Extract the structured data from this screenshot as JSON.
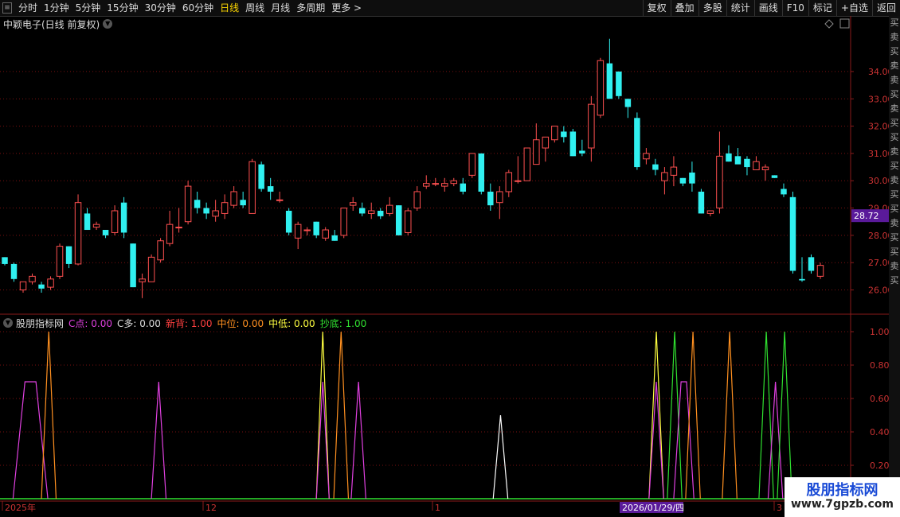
{
  "toolbar": {
    "periods": [
      "分时",
      "1分钟",
      "5分钟",
      "15分钟",
      "30分钟",
      "60分钟",
      "日线",
      "周线",
      "月线",
      "多周期",
      "更多 >"
    ],
    "active_period": "日线",
    "right_buttons": [
      "复权",
      "叠加",
      "多股",
      "统计",
      "画线",
      "F10",
      "标记",
      "+自选",
      "返回"
    ]
  },
  "main_title": "中颖电子(日线 前复权)",
  "indicator": {
    "name": "股朋指标网",
    "params": [
      {
        "label": "C点: 0.00",
        "color": "#e040e0"
      },
      {
        "label": "C多: 0.00",
        "color": "#dddddd"
      },
      {
        "label": "新背: 1.00",
        "color": "#ff4040"
      },
      {
        "label": "中位: 0.00",
        "color": "#ff9020"
      },
      {
        "label": "中低: 0.00",
        "color": "#ffff40"
      },
      {
        "label": "抄底: 1.00",
        "color": "#30e030"
      }
    ]
  },
  "price_axis": [
    "34.00",
    "33.00",
    "32.00",
    "31.00",
    "30.00",
    "29.00",
    "28.00",
    "27.00",
    "26.00"
  ],
  "current_price": "28.72",
  "ind_axis": [
    "1.00",
    "0.80",
    "0.60",
    "0.40",
    "0.20"
  ],
  "date_axis": {
    "labels": [
      "2025年",
      "12",
      "1",
      "3"
    ],
    "cursor": "2026/01/29/四"
  },
  "side_text": "买卖买卖卖买卖买买卖买卖买买卖买买卖买",
  "watermark": {
    "title": "股朋指标网",
    "url": "www.7gpzb.com"
  },
  "colors": {
    "up": "#ff5050",
    "down": "#30f0f0",
    "grid": "#7a1010",
    "axis": "#8a1a1a",
    "price_tag": "#5a1a9a",
    "date_tag": "#5a1a9a"
  },
  "chart_data": {
    "type": "candlestick",
    "title": "中颖电子(日线 前复权)",
    "ylim": [
      25.2,
      35.6
    ],
    "candles": [
      [
        27.2,
        27.2,
        26.9,
        26.95
      ],
      [
        26.95,
        27.0,
        26.3,
        26.4
      ],
      [
        26.0,
        26.3,
        25.9,
        26.3
      ],
      [
        26.3,
        26.6,
        26.2,
        26.5
      ],
      [
        26.2,
        26.3,
        25.9,
        26.05
      ],
      [
        26.1,
        26.5,
        26.0,
        26.4
      ],
      [
        26.5,
        27.7,
        26.4,
        27.6
      ],
      [
        27.6,
        27.6,
        26.8,
        26.95
      ],
      [
        26.95,
        29.5,
        26.9,
        29.2
      ],
      [
        28.8,
        29.0,
        28.2,
        28.2
      ],
      [
        28.3,
        28.5,
        28.2,
        28.4
      ],
      [
        28.2,
        28.2,
        27.9,
        28.0
      ],
      [
        28.1,
        29.1,
        28.0,
        28.9
      ],
      [
        29.2,
        29.4,
        27.9,
        28.1
      ],
      [
        27.7,
        27.7,
        26.1,
        26.1
      ],
      [
        26.3,
        26.6,
        25.7,
        26.4
      ],
      [
        26.3,
        27.3,
        26.3,
        27.2
      ],
      [
        27.1,
        27.9,
        27.0,
        27.8
      ],
      [
        27.7,
        28.9,
        27.6,
        28.4
      ],
      [
        28.3,
        29.0,
        28.1,
        28.3
      ],
      [
        28.5,
        30.0,
        28.4,
        29.8
      ],
      [
        29.3,
        29.6,
        28.8,
        29.0
      ],
      [
        29.0,
        29.2,
        28.6,
        28.8
      ],
      [
        28.7,
        29.3,
        28.5,
        28.9
      ],
      [
        28.8,
        29.5,
        28.6,
        29.2
      ],
      [
        29.1,
        29.8,
        29.0,
        29.6
      ],
      [
        29.3,
        29.6,
        29.0,
        29.1
      ],
      [
        28.8,
        30.8,
        28.8,
        30.7
      ],
      [
        30.6,
        30.7,
        29.6,
        29.7
      ],
      [
        29.8,
        30.1,
        29.3,
        29.6
      ],
      [
        29.3,
        29.6,
        29.2,
        29.3
      ],
      [
        28.9,
        29.0,
        28.0,
        28.1
      ],
      [
        27.9,
        28.5,
        27.5,
        28.4
      ],
      [
        28.2,
        28.3,
        28.0,
        28.2
      ],
      [
        28.5,
        28.5,
        27.9,
        28.0
      ],
      [
        27.9,
        28.3,
        27.8,
        28.2
      ],
      [
        28.0,
        28.2,
        27.8,
        27.8
      ],
      [
        28.0,
        29.0,
        27.9,
        29.0
      ],
      [
        29.1,
        29.4,
        28.9,
        29.2
      ],
      [
        29.0,
        29.2,
        28.7,
        28.8
      ],
      [
        28.8,
        29.2,
        28.6,
        28.9
      ],
      [
        28.9,
        29.0,
        28.6,
        28.7
      ],
      [
        28.8,
        29.4,
        28.7,
        29.1
      ],
      [
        29.1,
        29.1,
        28.0,
        28.0
      ],
      [
        28.1,
        29.0,
        28.0,
        28.9
      ],
      [
        29.0,
        29.8,
        28.9,
        29.6
      ],
      [
        29.8,
        30.2,
        29.7,
        29.9
      ],
      [
        29.9,
        30.1,
        29.8,
        29.9
      ],
      [
        29.8,
        30.1,
        29.6,
        29.9
      ],
      [
        29.9,
        30.1,
        29.8,
        30.0
      ],
      [
        29.9,
        30.1,
        29.5,
        29.6
      ],
      [
        30.2,
        31.0,
        30.1,
        31.0
      ],
      [
        31.0,
        31.0,
        29.5,
        29.6
      ],
      [
        29.6,
        29.9,
        28.9,
        29.1
      ],
      [
        29.2,
        29.8,
        28.6,
        29.6
      ],
      [
        29.6,
        30.4,
        29.4,
        30.3
      ],
      [
        30.0,
        30.9,
        29.9,
        30.0
      ],
      [
        30.0,
        31.2,
        30.0,
        31.2
      ],
      [
        30.6,
        32.1,
        30.6,
        31.5
      ],
      [
        31.2,
        31.6,
        30.7,
        31.6
      ],
      [
        31.5,
        32.0,
        31.4,
        32.0
      ],
      [
        31.8,
        32.0,
        31.4,
        31.6
      ],
      [
        31.8,
        31.9,
        30.9,
        30.9
      ],
      [
        31.1,
        31.5,
        30.9,
        31.0
      ],
      [
        31.2,
        33.1,
        30.7,
        32.8
      ],
      [
        32.4,
        34.5,
        32.3,
        34.4
      ],
      [
        34.3,
        35.2,
        33.1,
        33.0
      ],
      [
        34.0,
        34.0,
        33.0,
        33.1
      ],
      [
        33.0,
        33.0,
        32.3,
        32.7
      ],
      [
        32.3,
        32.5,
        30.4,
        30.5
      ],
      [
        30.8,
        31.2,
        30.6,
        31.0
      ],
      [
        30.6,
        30.8,
        30.2,
        30.4
      ],
      [
        30.0,
        30.5,
        29.5,
        30.3
      ],
      [
        30.2,
        30.9,
        29.8,
        30.5
      ],
      [
        30.1,
        30.1,
        29.8,
        29.9
      ],
      [
        30.3,
        30.7,
        29.6,
        29.9
      ],
      [
        29.6,
        29.7,
        28.8,
        28.8
      ],
      [
        28.8,
        28.9,
        28.7,
        28.9
      ],
      [
        29.0,
        31.8,
        28.8,
        30.9
      ],
      [
        31.0,
        31.3,
        30.7,
        30.7
      ],
      [
        30.9,
        31.2,
        30.7,
        30.6
      ],
      [
        30.8,
        30.9,
        30.2,
        30.5
      ],
      [
        30.4,
        30.9,
        30.4,
        30.7
      ],
      [
        30.4,
        30.6,
        30.0,
        30.5
      ],
      [
        30.2,
        30.2,
        30.1,
        30.1
      ],
      [
        29.7,
        29.9,
        29.4,
        29.5
      ],
      [
        29.4,
        29.6,
        26.6,
        26.7
      ],
      [
        26.4,
        27.2,
        26.3,
        26.35
      ],
      [
        27.2,
        27.3,
        26.6,
        26.7
      ],
      [
        26.5,
        27.0,
        26.4,
        26.9
      ]
    ]
  }
}
